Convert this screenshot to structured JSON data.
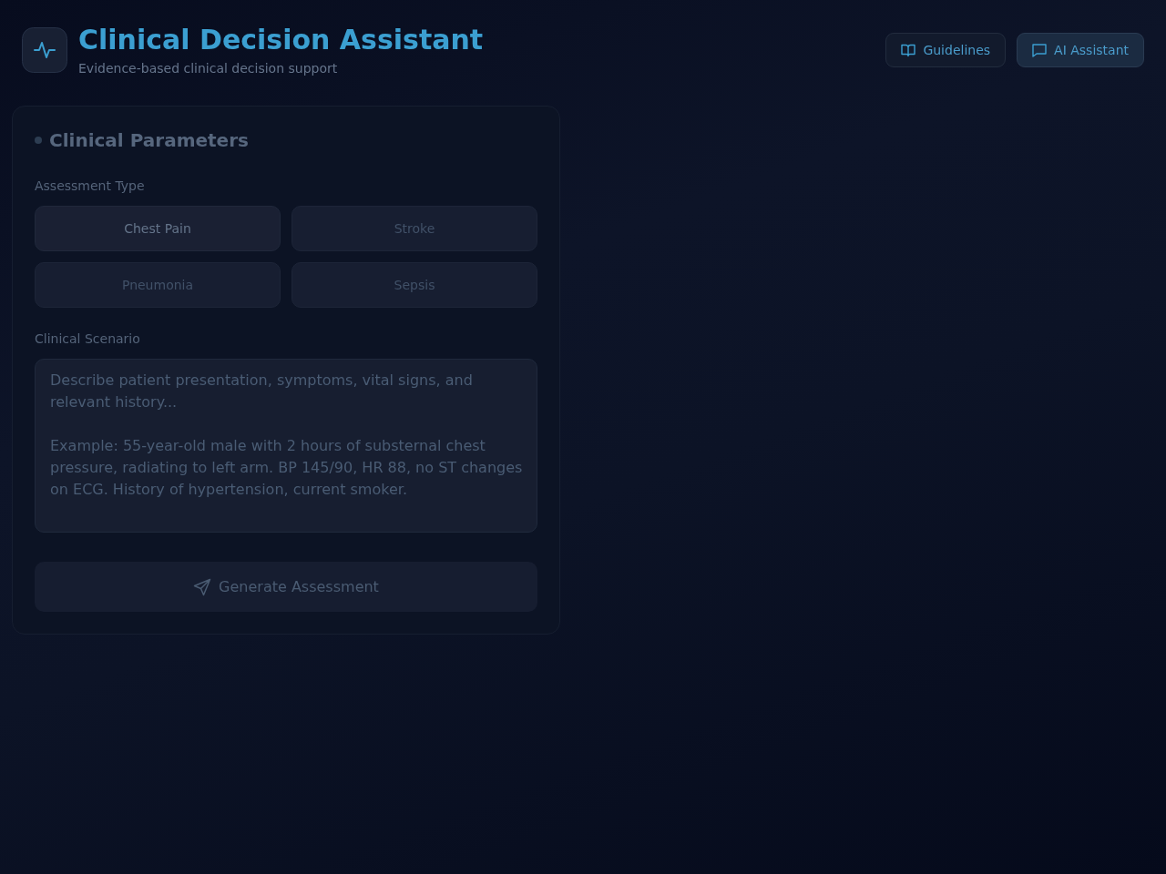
{
  "header": {
    "title": "Clinical Decision Assistant",
    "subtitle": "Evidence-based clinical decision support"
  },
  "nav_buttons": [
    {
      "label": "Guidelines",
      "kind": "book",
      "selected": false
    },
    {
      "label": "AI Assistant",
      "kind": "chat",
      "selected": true
    }
  ],
  "panel": {
    "title": "Clinical Parameters",
    "assessment_label": "Assessment Type",
    "assessment_types": [
      {
        "label": "Chest Pain",
        "selected": true
      },
      {
        "label": "Stroke",
        "selected": false
      },
      {
        "label": "Pneumonia",
        "selected": false
      },
      {
        "label": "Sepsis",
        "selected": false
      }
    ],
    "scenario_label": "Clinical Scenario",
    "scenario": {
      "placeholder": "Describe patient presentation, symptoms, vital signs, and relevant history...\n\nExample: 55-year-old male with 2 hours of substernal chest pressure, radiating to left arm. BP 145/90, HR 88, no ST changes on ECG. History of hypertension, current smoker."
    },
    "submit": {
      "label": "Generate Assessment",
      "disabled": true
    }
  }
}
